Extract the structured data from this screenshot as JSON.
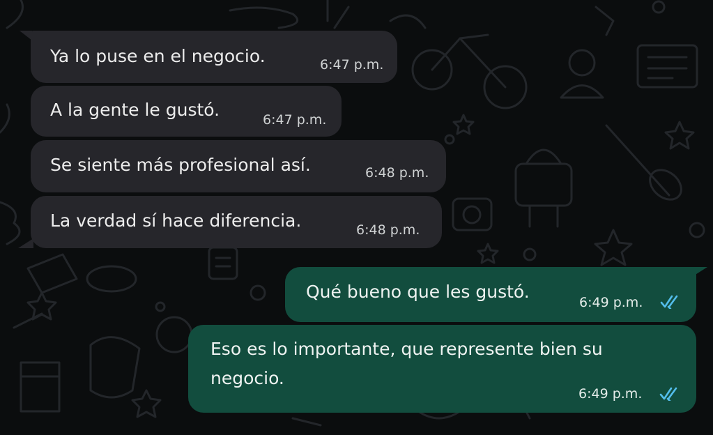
{
  "chat": {
    "messages": [
      {
        "direction": "incoming",
        "text": "Ya lo puse en el negocio.",
        "time": "6:47 p.m."
      },
      {
        "direction": "incoming",
        "text": "A la gente le gustó.",
        "time": "6:47 p.m."
      },
      {
        "direction": "incoming",
        "text": "Se siente más profesional así.",
        "time": "6:48 p.m."
      },
      {
        "direction": "incoming",
        "text": "La verdad sí hace diferencia.",
        "time": "6:48 p.m."
      },
      {
        "direction": "outgoing",
        "text": "Qué bueno que les gustó.",
        "time": "6:49 p.m.",
        "status": "read"
      },
      {
        "direction": "outgoing",
        "text": "Eso es lo importante, que represente bien su negocio.",
        "time": "6:49 p.m.",
        "status": "read"
      }
    ]
  },
  "colors": {
    "background": "#0b0d0e",
    "incoming_bubble": "#26262b",
    "outgoing_bubble": "#124d3e",
    "read_ticks": "#53bdeb",
    "doodle_stroke": "#23262a"
  },
  "icons": {
    "read_receipt": "double-check-icon",
    "wallpaper": "doodle-pattern"
  }
}
